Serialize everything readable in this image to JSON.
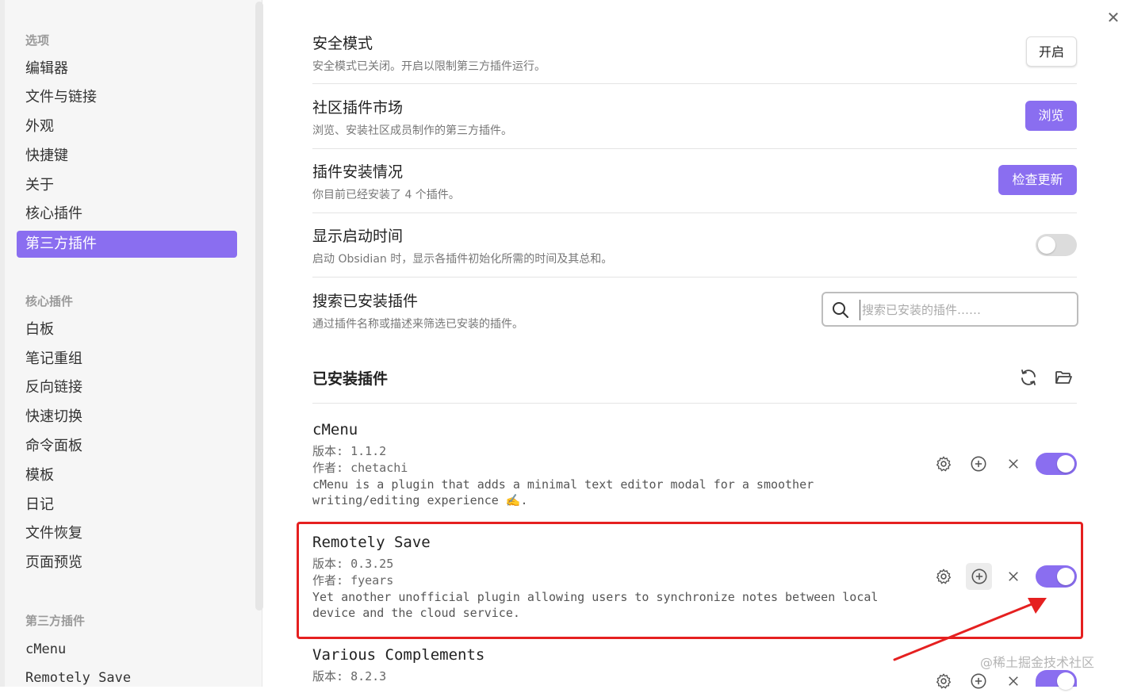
{
  "sidebar": {
    "heading_options": "选项",
    "options": [
      "编辑器",
      "文件与链接",
      "外观",
      "快捷键",
      "关于",
      "核心插件",
      "第三方插件"
    ],
    "active_index": 6,
    "heading_core": "核心插件",
    "core": [
      "白板",
      "笔记重组",
      "反向链接",
      "快速切换",
      "命令面板",
      "模板",
      "日记",
      "文件恢复",
      "页面预览"
    ],
    "heading_third": "第三方插件",
    "third": [
      "cMenu",
      "Remotely Save"
    ]
  },
  "settings": {
    "safe_mode": {
      "name": "安全模式",
      "desc": "安全模式已关闭。开启以限制第三方插件运行。",
      "button": "开启"
    },
    "community": {
      "name": "社区插件市场",
      "desc": "浏览、安装社区成员制作的第三方插件。",
      "button": "浏览"
    },
    "installed_status": {
      "name": "插件安装情况",
      "desc": "你目前已经安装了 4 个插件。",
      "button": "检查更新"
    },
    "startup_time": {
      "name": "显示启动时间",
      "desc": "启动 Obsidian 时，显示各插件初始化所需的时间及其总和。",
      "enabled": false
    },
    "search": {
      "name": "搜索已安装插件",
      "desc": "通过插件名称或描述来筛选已安装的插件。",
      "placeholder": "搜索已安装的插件……"
    }
  },
  "installed": {
    "title": "已安装插件",
    "plugins": [
      {
        "name": "cMenu",
        "version_label": "版本:",
        "version": "1.1.2",
        "author_label": "作者:",
        "author": "chetachi",
        "desc": "cMenu is a plugin that adds a minimal text editor modal for a smoother\nwriting/editing experience ✍️.",
        "enabled": true
      },
      {
        "name": "Remotely Save",
        "version_label": "版本:",
        "version": "0.3.25",
        "author_label": "作者:",
        "author": "fyears",
        "desc": "Yet another unofficial plugin allowing users to synchronize notes between local\ndevice and the cloud service.",
        "enabled": true
      },
      {
        "name": "Various Complements",
        "version_label": "版本:",
        "version": "8.2.3",
        "enabled": true
      }
    ]
  },
  "watermark": "@稀土掘金技术社区",
  "colors": {
    "accent": "#8a6ef0",
    "annotation": "#e52020"
  }
}
